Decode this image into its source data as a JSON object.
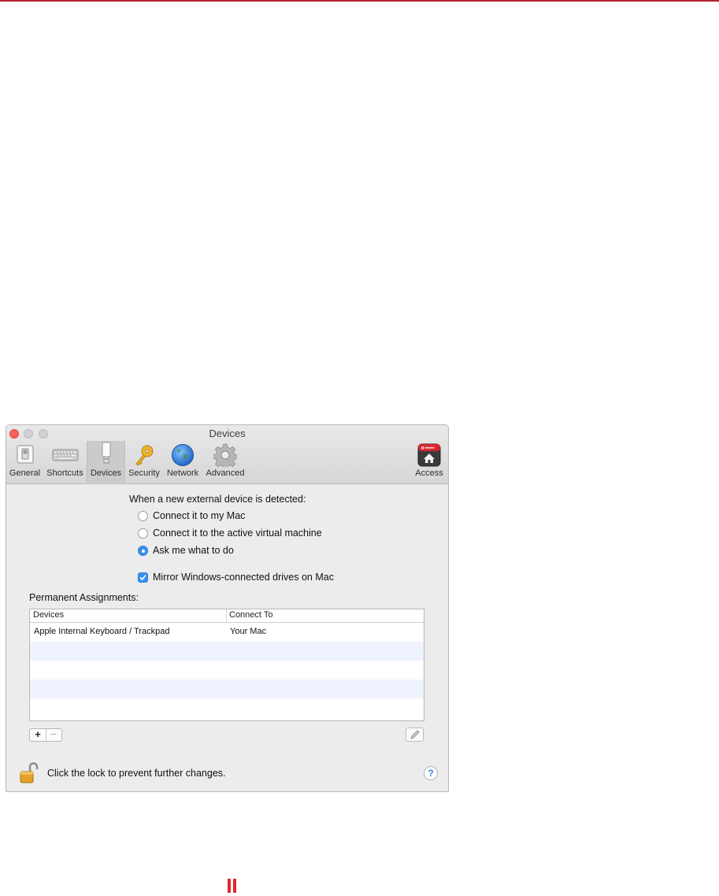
{
  "window": {
    "title": "Devices",
    "toolbar": [
      {
        "id": "general",
        "label": "General",
        "icon": "general-switch-icon"
      },
      {
        "id": "shortcuts",
        "label": "Shortcuts",
        "icon": "keyboard-icon"
      },
      {
        "id": "devices",
        "label": "Devices",
        "icon": "usb-drive-icon",
        "selected": true
      },
      {
        "id": "security",
        "label": "Security",
        "icon": "key-icon"
      },
      {
        "id": "network",
        "label": "Network",
        "icon": "globe-icon"
      },
      {
        "id": "advanced",
        "label": "Advanced",
        "icon": "gear-icon"
      },
      {
        "id": "access",
        "label": "Access",
        "icon": "parallels-access-icon"
      }
    ]
  },
  "devices_pane": {
    "prompt": "When a new external device is detected:",
    "options": [
      {
        "label": "Connect it to my Mac",
        "selected": false
      },
      {
        "label": "Connect it to the active virtual machine",
        "selected": false
      },
      {
        "label": "Ask me what to do",
        "selected": true
      }
    ],
    "mirror_checkbox": {
      "label": "Mirror Windows-connected drives on Mac",
      "checked": true
    },
    "assignments_title": "Permanent Assignments:",
    "table": {
      "columns": [
        "Devices",
        "Connect To"
      ],
      "rows": [
        {
          "device": "Apple Internal Keyboard / Trackpad",
          "connect_to": "Your Mac"
        }
      ]
    },
    "add_label": "+",
    "remove_label": "−",
    "lock_text": "Click the lock to prevent further changes.",
    "help_label": "?"
  },
  "colors": {
    "accent": "#3a8fee",
    "brand_red": "#e0262e"
  }
}
